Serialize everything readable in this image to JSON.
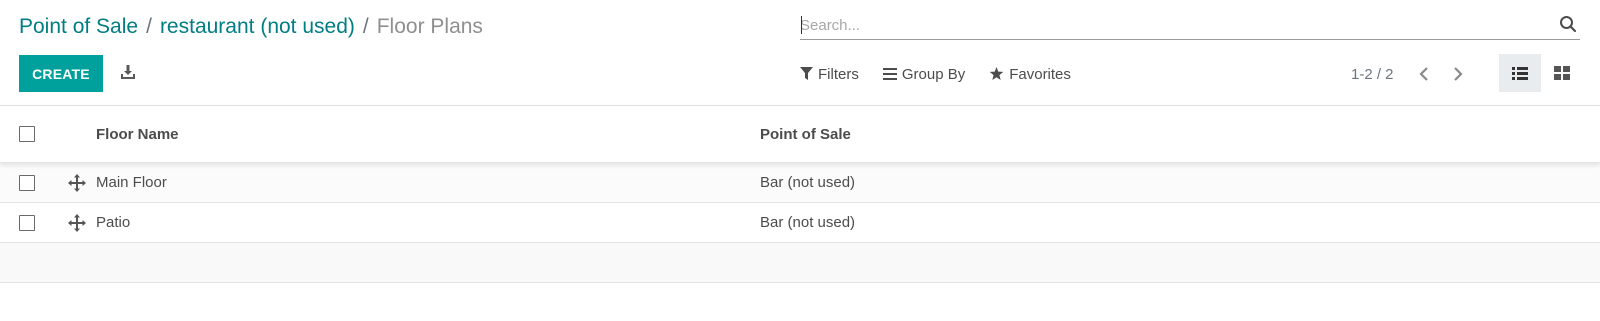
{
  "breadcrumb": {
    "items": [
      "Point of Sale",
      "restaurant (not used)"
    ],
    "separator": "/",
    "current": "Floor Plans"
  },
  "search": {
    "placeholder": "Search...",
    "value": ""
  },
  "toolbar": {
    "create_label": "CREATE",
    "download_icon": "download-icon"
  },
  "search_options": {
    "filters_label": "Filters",
    "group_by_label": "Group By",
    "favorites_label": "Favorites"
  },
  "pager": {
    "value": "1-2 / 2"
  },
  "views": {
    "active": "list",
    "available": [
      "list",
      "kanban"
    ]
  },
  "table": {
    "columns": [
      "Floor Name",
      "Point of Sale"
    ],
    "rows": [
      {
        "floor_name": "Main Floor",
        "point_of_sale": "Bar (not used)"
      },
      {
        "floor_name": "Patio",
        "point_of_sale": "Bar (not used)"
      }
    ]
  },
  "colors": {
    "brand_link": "#017e84",
    "primary_button": "#00a09d",
    "text": "#4c4c4c",
    "muted": "#8f8f8f"
  }
}
